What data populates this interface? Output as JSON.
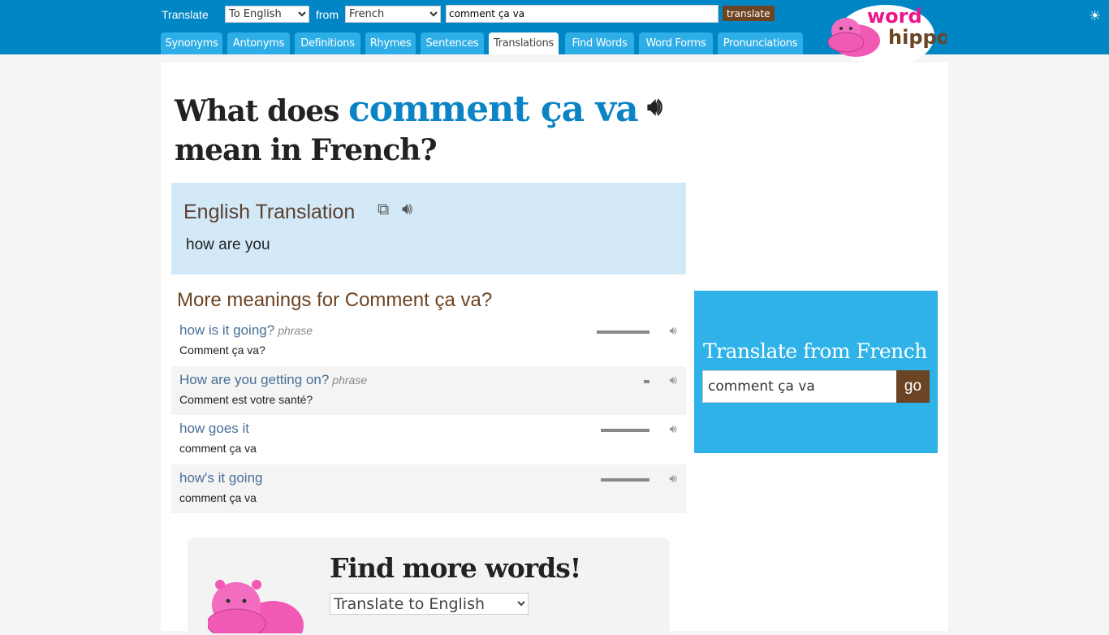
{
  "header": {
    "translate_label": "Translate",
    "to_select": "To English",
    "from_label": "from",
    "from_select": "French",
    "search_value": "comment ça va",
    "translate_button": "translate",
    "brightness_icon": "sun-icon",
    "tabs": [
      {
        "label": "Synonyms"
      },
      {
        "label": "Antonyms"
      },
      {
        "label": "Definitions"
      },
      {
        "label": "Rhymes"
      },
      {
        "label": "Sentences"
      },
      {
        "label": "Translations",
        "active": true
      },
      {
        "label": "Find Words"
      },
      {
        "label": "Word Forms"
      },
      {
        "label": "Pronunciations"
      }
    ],
    "logo": {
      "line1": "word",
      "line2": "hippo"
    }
  },
  "title": {
    "prefix": "What does",
    "word": "comment ça va",
    "suffix": "mean in French?"
  },
  "translation": {
    "heading": "English Translation",
    "value": "how are you"
  },
  "more": {
    "heading": "More meanings for Comment ça va?",
    "items": [
      {
        "en": "how is it going?",
        "type": "phrase",
        "fr": "Comment ça va?",
        "frequency": 1.0
      },
      {
        "en": "How are you getting on?",
        "type": "phrase",
        "fr": "Comment est votre santé?",
        "frequency": 0.1
      },
      {
        "en": "how goes it",
        "type": "",
        "fr": "comment ça va",
        "frequency": 0.92
      },
      {
        "en": "how's it going",
        "type": "",
        "fr": "comment ça va",
        "frequency": 0.92
      }
    ]
  },
  "sidebar": {
    "heading": "Translate from French",
    "input_value": "comment ça va",
    "go": "go"
  },
  "find_more": {
    "heading": "Find more words!",
    "select": "Translate to English"
  }
}
